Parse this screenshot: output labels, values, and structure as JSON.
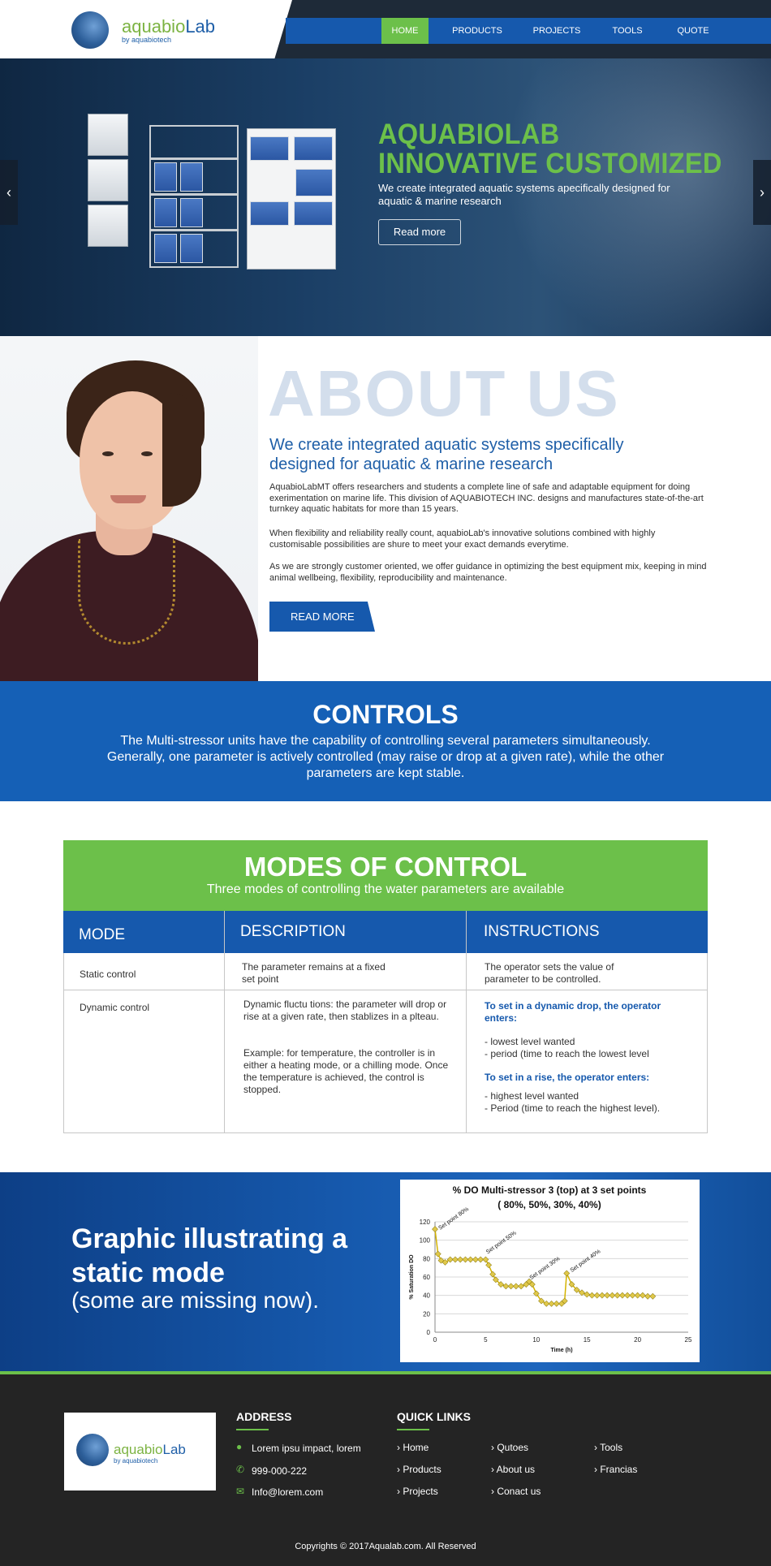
{
  "brand": {
    "name_part1": "aquabio",
    "name_part2": "Lab",
    "tagline": "by aquabiotech"
  },
  "nav": {
    "items": [
      "HOME",
      "PRODUCTS",
      "PROJECTS",
      "TOOLS",
      "QUOTE"
    ],
    "active": "HOME"
  },
  "hero": {
    "title_line1": "AQUABIOLAB",
    "title_line2": "INNOVATIVE CUSTOMIZED",
    "subtitle": "We create integrated aquatic systems apecifically designed for aquatic & marine research",
    "button": "Read more",
    "prev_icon": "chevron-left-icon",
    "next_icon": "chevron-right-icon"
  },
  "about": {
    "title": "ABOUT US",
    "lead": "We create integrated aquatic systems specifically designed for aquatic & marine research",
    "p1": "AquabioLabMT offers researchers and students a complete line of safe and adaptable equipment for doing exerimentation on marine life. This division of AQUABIOTECH INC. designs and manufactures state-of-the-art turnkey aquatic habitats for more than 15 years.",
    "p2": "When flexibility and reliability really count, aquabioLab's innovative solutions combined with highly customisable possibilities are shure to meet your exact demands everytime.",
    "p3": "As we are strongly customer oriented, we offer guidance in optimizing the best equipment mix, keeping in mind animal wellbeing, flexibility, reproducibility and maintenance.",
    "button": "READ MORE"
  },
  "controls": {
    "title": "CONTROLS",
    "text": "The Multi-stressor units have the capability of controlling several parameters simultaneously.  Generally, one parameter is actively controlled (may raise or drop at a given rate), while the other parameters are kept stable."
  },
  "modes": {
    "title": "MODES OF CONTROL",
    "subtitle": "Three modes of controlling the water parameters are available",
    "headers": [
      "MODE",
      "DESCRIPTION",
      "INSTRUCTIONS"
    ],
    "rows": [
      {
        "mode": "Static control",
        "description": "The parameter remains at a fixed set point",
        "instructions": "The operator sets the value of parameter to be controlled."
      },
      {
        "mode": "Dynamic control",
        "description": "Dynamic fluctu tions: the parameter will drop or rise at a given rate, then stablizes in a plteau.",
        "description2": "Example:  for temperature, the controller is in either a heating mode, or a chilling mode.  Once the temperature is achieved, the control is stopped.",
        "drop_heading": "To set in a dynamic drop, the operator enters:",
        "drop_item1": "- lowest level wanted",
        "drop_item2": "- period (time to reach the lowest level",
        "rise_heading": "To set in a rise, the operator enters:",
        "rise_item1": "- highest level wanted",
        "rise_item2": "- Period (time to reach the highest level)."
      }
    ]
  },
  "graphic": {
    "title": "Graphic illustrating a static mode",
    "subtitle": "(some are missing now)."
  },
  "chart_data": {
    "type": "line",
    "title_line1": "% DO Multi-stressor 3 (top) at 3 set points",
    "title_line2": "( 80%, 50%, 30%, 40%)",
    "xlabel": "Time (h)",
    "ylabel": "% Saturation DO",
    "xlim": [
      0,
      25
    ],
    "ylim": [
      0,
      120
    ],
    "xticks": [
      0,
      5,
      10,
      15,
      20,
      25
    ],
    "yticks": [
      0,
      20,
      40,
      60,
      80,
      100,
      120
    ],
    "grid": true,
    "line_color": "#d4b300",
    "marker_color": "#e0c84a",
    "annotations": [
      {
        "text": "Set point 80%",
        "x": 0.5
      },
      {
        "text": "Set point 50%",
        "x": 5.2
      },
      {
        "text": "Set point 30%",
        "x": 9.5
      },
      {
        "text": "Set point 40%",
        "x": 13.5
      }
    ],
    "x": [
      0,
      0.3,
      0.6,
      1,
      1.5,
      2,
      2.5,
      3,
      3.5,
      4,
      4.5,
      5,
      5.3,
      5.7,
      6,
      6.5,
      7,
      7.5,
      8,
      8.5,
      9,
      9.3,
      9.6,
      10,
      10.5,
      11,
      11.5,
      12,
      12.5,
      12.8,
      13,
      13.5,
      14,
      14.5,
      15,
      15.5,
      16,
      16.5,
      17,
      17.5,
      18,
      18.5,
      19,
      19.5,
      20,
      20.5,
      21,
      21.5
    ],
    "y": [
      112,
      85,
      78,
      76,
      79,
      79,
      79,
      79,
      79,
      79,
      79,
      79,
      73,
      63,
      57,
      52,
      50,
      50,
      50,
      50,
      52,
      55,
      52,
      42,
      34,
      31,
      31,
      31,
      31,
      34,
      64,
      52,
      46,
      43,
      41,
      40,
      40,
      40,
      40,
      40,
      40,
      40,
      40,
      40,
      40,
      40,
      39,
      39
    ]
  },
  "footer": {
    "address_heading": "ADDRESS",
    "address": "Lorem ipsu impact, lorem",
    "phone": "999-000-222",
    "email": "Info@lorem.com",
    "quick_links_heading": "QUICK LINKS",
    "links_col1": [
      "Home",
      "Products",
      "Projects"
    ],
    "links_col2": [
      "Qutoes",
      "About us",
      "Conact us"
    ],
    "links_col3": [
      "Tools",
      "Francias"
    ],
    "copyright": "Copyrights © 2017Aqualab.com.    All Reserved",
    "accent_color": "#6cc04a"
  }
}
